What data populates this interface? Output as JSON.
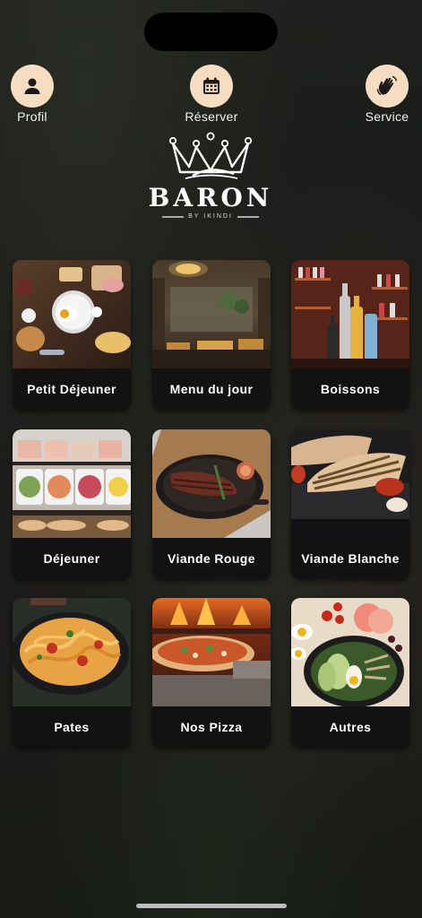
{
  "header": {
    "profile_label": "Profil",
    "reserve_label": "Réserver",
    "service_label": "Service"
  },
  "logo": {
    "word": "BARON",
    "sub": "BY IKINDI"
  },
  "menu": {
    "items": [
      {
        "label": "Petit Déjeuner"
      },
      {
        "label": "Menu du jour"
      },
      {
        "label": "Boissons"
      },
      {
        "label": "Déjeuner"
      },
      {
        "label": "Viande Rouge"
      },
      {
        "label": "Viande Blanche"
      },
      {
        "label": "Pates"
      },
      {
        "label": "Nos Pizza"
      },
      {
        "label": "Autres"
      }
    ]
  },
  "colors": {
    "accent_circle": "#f6dcc0",
    "card_bg": "#121212"
  }
}
